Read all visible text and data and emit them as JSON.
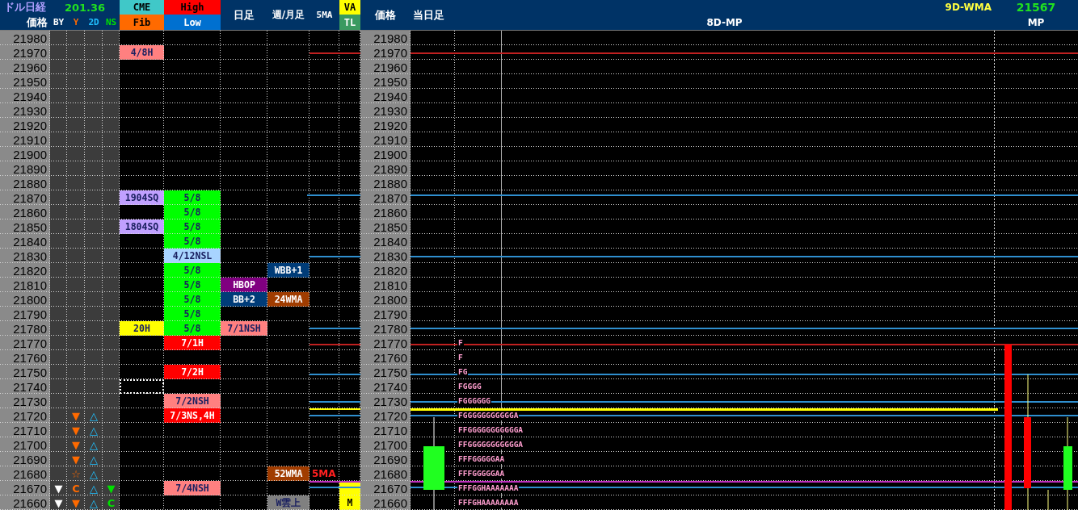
{
  "header": {
    "title": "ドル日経",
    "rate": "201.36",
    "price": "価格",
    "marks": [
      "BY",
      "Y",
      "2D",
      "NS"
    ],
    "cme": "CME",
    "fib": "Fib",
    "high": "High",
    "low": "Low",
    "daily": "日足",
    "weekly": "週/月足",
    "ma5": "5MA",
    "va": "VA",
    "tl": "TL",
    "price_2": "価格",
    "today": "当日足",
    "profile": "8D-MP",
    "wma_label": "9D-WMA",
    "wma_value": "21567",
    "mp": "MP"
  },
  "rows": [
    {
      "price": "21980",
      "price_2": "21980",
      "selected": false
    },
    {
      "price": "21970",
      "price_2": "21970",
      "selected": false,
      "cme": {
        "text": "4/8H",
        "color": "#ff8080"
      }
    },
    {
      "price": "21960",
      "price_2": "21960",
      "selected": false
    },
    {
      "price": "21950",
      "price_2": "21950",
      "selected": false
    },
    {
      "price": "21940",
      "price_2": "21940",
      "selected": false
    },
    {
      "price": "21930",
      "price_2": "21930",
      "selected": false
    },
    {
      "price": "21920",
      "price_2": "21920",
      "selected": false
    },
    {
      "price": "21910",
      "price_2": "21910",
      "selected": false
    },
    {
      "price": "21900",
      "price_2": "21900",
      "selected": false
    },
    {
      "price": "21890",
      "price_2": "21890",
      "selected": false
    },
    {
      "price": "21880",
      "price_2": "21880",
      "selected": false
    },
    {
      "price": "21870",
      "price_2": "21870",
      "selected": false,
      "cme": {
        "text": "1904SQ",
        "color": "#c0a0ff"
      },
      "high_low": {
        "text": "5/8",
        "color": "#00ff00"
      }
    },
    {
      "price": "21860",
      "price_2": "21860",
      "selected": false,
      "high_low": {
        "text": "5/8",
        "color": "#00ff00"
      }
    },
    {
      "price": "21850",
      "price_2": "21850",
      "selected": false,
      "cme": {
        "text": "1804SQ",
        "color": "#c0a0ff"
      },
      "high_low": {
        "text": "5/8",
        "color": "#00ff00"
      }
    },
    {
      "price": "21840",
      "price_2": "21840",
      "selected": false,
      "high_low": {
        "text": "5/8",
        "color": "#00ff00"
      }
    },
    {
      "price": "21830",
      "price_2": "21830",
      "selected": false,
      "high_low": {
        "text": "4/12NSL",
        "color": "#a8d4ff"
      }
    },
    {
      "price": "21820",
      "price_2": "21820",
      "selected": false,
      "high_low": {
        "text": "5/8",
        "color": "#00ff00"
      },
      "weekly": {
        "text": "WBB+1",
        "color": "#003c78"
      }
    },
    {
      "price": "21810",
      "price_2": "21810",
      "selected": false,
      "high_low": {
        "text": "5/8",
        "color": "#00ff00"
      },
      "daily": {
        "text": "HBOP",
        "color": "#800080"
      }
    },
    {
      "price": "21800",
      "price_2": "21800",
      "selected": false,
      "high_low": {
        "text": "5/8",
        "color": "#00ff00"
      },
      "daily": {
        "text": "BB+2",
        "color": "#003c78"
      },
      "weekly": {
        "text": "24WMA",
        "color": "#a03c00"
      }
    },
    {
      "price": "21790",
      "price_2": "21790",
      "selected": false,
      "high_low": {
        "text": "5/8",
        "color": "#00ff00"
      }
    },
    {
      "price": "21780",
      "price_2": "21780",
      "selected": false,
      "cme": {
        "text": "20H",
        "color": "#ffff00"
      },
      "high_low": {
        "text": "5/8",
        "color": "#00ff00"
      },
      "daily": {
        "text": "7/1NSH",
        "color": "#ff8080"
      }
    },
    {
      "price": "21770",
      "price_2": "21770",
      "selected": false,
      "high_low": {
        "text": "7/1H",
        "color": "#ff0000"
      },
      "profile": "F"
    },
    {
      "price": "21760",
      "price_2": "21760",
      "selected": false,
      "profile": "F"
    },
    {
      "price": "21750",
      "price_2": "21750",
      "selected": false,
      "high_low": {
        "text": "7/2H",
        "color": "#ff0000"
      },
      "profile": "FG"
    },
    {
      "price": "21740",
      "price_2": "21740",
      "selected": true,
      "profile": "FGGGG"
    },
    {
      "price": "21730",
      "price_2": "21730",
      "selected": false,
      "high_low": {
        "text": "7/2NSH",
        "color": "#ff8080"
      },
      "profile": "FGGGGGG"
    },
    {
      "price": "21720",
      "price_2": "21720",
      "selected": false,
      "y": "▼",
      "d2": "△",
      "high_low": {
        "text": "7/3NS,4H",
        "color": "#ff0000"
      },
      "profile": "FGGGGGGGGGGGA"
    },
    {
      "price": "21710",
      "price_2": "21710",
      "selected": false,
      "y": "▼",
      "d2": "△",
      "profile": "FFGGGGGGGGGGGA"
    },
    {
      "price": "21700",
      "price_2": "21700",
      "selected": false,
      "y": "▼",
      "d2": "△",
      "profile": "FFGGGGGGGGGGGA"
    },
    {
      "price": "21690",
      "price_2": "21690",
      "selected": false,
      "y": "▼",
      "d2": "△",
      "profile": "FFFGGGGGAA"
    },
    {
      "price": "21680",
      "price_2": "21680",
      "selected": false,
      "y": "☆",
      "d2": "△",
      "weekly": {
        "text": "52WMA",
        "color": "#a03c00"
      },
      "ma5": {
        "text": "5MA",
        "color": "#ff2020"
      },
      "profile": "FFFGGGGGAA"
    },
    {
      "price": "21670",
      "price_2": "21670",
      "selected": false,
      "by": "▼",
      "y": "C",
      "d2": "△",
      "ns": "▼",
      "high_low": {
        "text": "7/4NSH",
        "color": "#ff8080"
      },
      "va": {
        "color": "#ffff00"
      },
      "profile": "FFFGGHAAAAAAA"
    },
    {
      "price": "21660",
      "price_2": "21660",
      "selected": false,
      "by": "▼",
      "y": "▼",
      "d2": "△",
      "ns": "C",
      "weekly": {
        "text": "W雲上",
        "color": "#808080"
      },
      "va": {
        "text": "M",
        "color": "#ffff00"
      },
      "profile": "FFFGHAAAAAAAA"
    }
  ]
}
